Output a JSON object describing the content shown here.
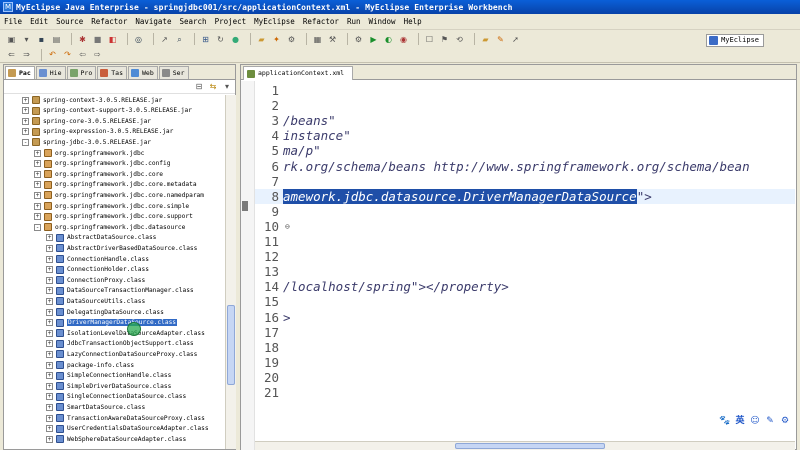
{
  "window": {
    "title": "MyEclipse Java Enterprise - springjdbc001/src/applicationContext.xml - MyEclipse Enterprise Workbench"
  },
  "menu": [
    "File",
    "Edit",
    "Source",
    "Refactor",
    "Navigate",
    "Search",
    "Project",
    "MyEclipse",
    "Refactor",
    "Run",
    "Window",
    "Help"
  ],
  "perspective": {
    "label": "MyEclipse"
  },
  "left_tabs": [
    {
      "label": "Pac",
      "color": "#c49a52"
    },
    {
      "label": "Hie",
      "color": "#6a8fd0"
    },
    {
      "label": "Pro",
      "color": "#7aa36a"
    },
    {
      "label": "Tas",
      "color": "#c95e3c"
    },
    {
      "label": "Web",
      "color": "#4f8bd5"
    },
    {
      "label": "Ser",
      "color": "#8a8a8a"
    }
  ],
  "tree": [
    {
      "level": 1,
      "exp": "+",
      "icon": "jar",
      "label": "spring-context-3.0.5.RELEASE.jar"
    },
    {
      "level": 1,
      "exp": "+",
      "icon": "jar",
      "label": "spring-context-support-3.0.5.RELEASE.jar"
    },
    {
      "level": 1,
      "exp": "+",
      "icon": "jar",
      "label": "spring-core-3.0.5.RELEASE.jar"
    },
    {
      "level": 1,
      "exp": "+",
      "icon": "jar",
      "label": "spring-expression-3.0.5.RELEASE.jar"
    },
    {
      "level": 1,
      "exp": "-",
      "icon": "jar",
      "label": "spring-jdbc-3.0.5.RELEASE.jar"
    },
    {
      "level": 2,
      "exp": "+",
      "icon": "pkg",
      "label": "org.springframework.jdbc"
    },
    {
      "level": 2,
      "exp": "+",
      "icon": "pkg",
      "label": "org.springframework.jdbc.config"
    },
    {
      "level": 2,
      "exp": "+",
      "icon": "pkg",
      "label": "org.springframework.jdbc.core"
    },
    {
      "level": 2,
      "exp": "+",
      "icon": "pkg",
      "label": "org.springframework.jdbc.core.metadata"
    },
    {
      "level": 2,
      "exp": "+",
      "icon": "pkg",
      "label": "org.springframework.jdbc.core.namedparam"
    },
    {
      "level": 2,
      "exp": "+",
      "icon": "pkg",
      "label": "org.springframework.jdbc.core.simple"
    },
    {
      "level": 2,
      "exp": "+",
      "icon": "pkg",
      "label": "org.springframework.jdbc.core.support"
    },
    {
      "level": 2,
      "exp": "-",
      "icon": "pkg",
      "label": "org.springframework.jdbc.datasource"
    },
    {
      "level": 3,
      "exp": "+",
      "icon": "cls",
      "label": "AbstractDataSource.class"
    },
    {
      "level": 3,
      "exp": "+",
      "icon": "cls",
      "label": "AbstractDriverBasedDataSource.class"
    },
    {
      "level": 3,
      "exp": "+",
      "icon": "cls",
      "label": "ConnectionHandle.class"
    },
    {
      "level": 3,
      "exp": "+",
      "icon": "cls",
      "label": "ConnectionHolder.class"
    },
    {
      "level": 3,
      "exp": "+",
      "icon": "cls",
      "label": "ConnectionProxy.class"
    },
    {
      "level": 3,
      "exp": "+",
      "icon": "cls",
      "label": "DataSourceTransactionManager.class"
    },
    {
      "level": 3,
      "exp": "+",
      "icon": "cls",
      "label": "DataSourceUtils.class"
    },
    {
      "level": 3,
      "exp": "+",
      "icon": "cls",
      "label": "DelegatingDataSource.class"
    },
    {
      "level": 3,
      "exp": "+",
      "icon": "cls",
      "label": "DriverManagerDataSource.class",
      "selected": true
    },
    {
      "level": 3,
      "exp": "+",
      "icon": "cls",
      "label": "IsolationLevelDataSourceAdapter.class"
    },
    {
      "level": 3,
      "exp": "+",
      "icon": "cls",
      "label": "JdbcTransactionObjectSupport.class"
    },
    {
      "level": 3,
      "exp": "+",
      "icon": "cls",
      "label": "LazyConnectionDataSourceProxy.class"
    },
    {
      "level": 3,
      "exp": "+",
      "icon": "cls",
      "label": "package-info.class"
    },
    {
      "level": 3,
      "exp": "+",
      "icon": "cls",
      "label": "SimpleConnectionHandle.class"
    },
    {
      "level": 3,
      "exp": "+",
      "icon": "cls",
      "label": "SimpleDriverDataSource.class"
    },
    {
      "level": 3,
      "exp": "+",
      "icon": "cls",
      "label": "SingleConnectionDataSource.class"
    },
    {
      "level": 3,
      "exp": "+",
      "icon": "cls",
      "label": "SmartDataSource.class"
    },
    {
      "level": 3,
      "exp": "+",
      "icon": "cls",
      "label": "TransactionAwareDataSourceProxy.class"
    },
    {
      "level": 3,
      "exp": "+",
      "icon": "cls",
      "label": "UserCredentialsDataSourceAdapter.class"
    },
    {
      "level": 3,
      "exp": "+",
      "icon": "cls",
      "label": "WebSphereDataSourceAdapter.class"
    }
  ],
  "editor": {
    "tab_label": "applicationContext.xml",
    "lines": [
      {
        "num": "1",
        "code": ""
      },
      {
        "num": "2",
        "code": ""
      },
      {
        "num": "3",
        "code": "/beans\""
      },
      {
        "num": "4",
        "code": "instance\""
      },
      {
        "num": "5",
        "code": "ma/p\""
      },
      {
        "num": "6",
        "code": "rk.org/schema/beans http://www.springframework.org/schema/bean"
      },
      {
        "num": "7",
        "code": ""
      },
      {
        "num": "8",
        "code": "amework.jdbc.datasource.DriverManagerDataSource",
        "tail": "\">",
        "highlight": true
      },
      {
        "num": "9",
        "code": ""
      },
      {
        "num": "10",
        "code": "",
        "fold": "⊖"
      },
      {
        "num": "11",
        "code": ""
      },
      {
        "num": "12",
        "code": ""
      },
      {
        "num": "13",
        "code": ""
      },
      {
        "num": "14",
        "code": "/localhost/spring\"></property>"
      },
      {
        "num": "15",
        "code": ""
      },
      {
        "num": "16",
        "code": ">"
      },
      {
        "num": "17",
        "code": ""
      },
      {
        "num": "18",
        "code": ""
      },
      {
        "num": "19",
        "code": ""
      },
      {
        "num": "20",
        "code": ""
      },
      {
        "num": "21",
        "code": ""
      }
    ]
  },
  "ime": [
    "🐾",
    "英",
    "☺",
    "✎",
    "⚙"
  ],
  "colors": {
    "selection": "#316ac5",
    "title_bar": "#0a5fd8"
  }
}
